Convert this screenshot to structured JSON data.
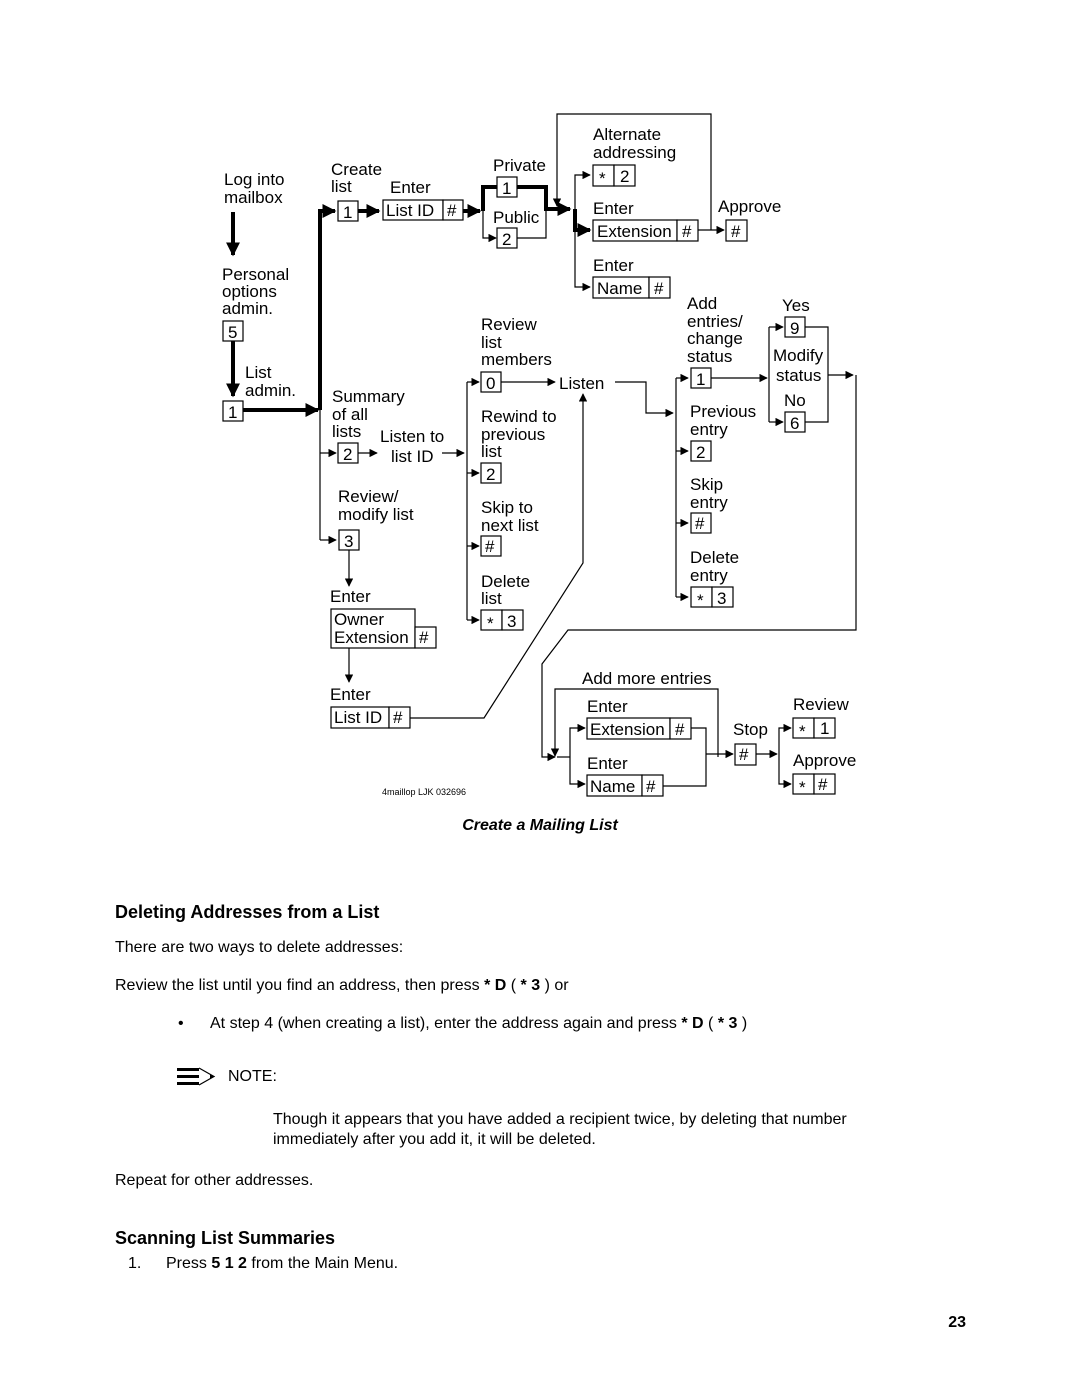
{
  "diagram": {
    "title": "Create a Mailing List",
    "credit": "4maillop LJK 032696",
    "labels": {
      "log_into": "Log into",
      "mailbox": "mailbox",
      "personal": "Personal",
      "options": "options",
      "admin": "admin.",
      "key_5": "5",
      "list": "List",
      "list_admin": "admin.",
      "key_1_admin": "1",
      "create": "Create",
      "create_list": "list",
      "key_1_create": "1",
      "enter_listid": "Enter",
      "listid": "List ID",
      "hash": "#",
      "private": "Private",
      "key_private": "1",
      "public": "Public",
      "key_public": "2",
      "alternate": "Alternate",
      "addressing": "addressing",
      "star": "*",
      "key_alt": "2",
      "enter_ext": "Enter",
      "extension": "Extension",
      "approve": "Approve",
      "enter_name": "Enter",
      "name": "Name",
      "summary": "Summary",
      "of_all": "of all",
      "lists": "lists",
      "key_summary": "2",
      "listen_to": "Listen to",
      "list_id": "list ID",
      "review_modify": "Review/",
      "modify_list": "modify list",
      "key_review": "3",
      "enter_owner": "Enter",
      "owner": "Owner",
      "owner_ext": "Extension",
      "enter_listid2": "Enter",
      "listid2": "List ID",
      "review": "Review",
      "review_list": "list",
      "members": "members",
      "key_0": "0",
      "listen": "Listen",
      "rewind_to": "Rewind to",
      "previous": "previous",
      "rewind_list": "list",
      "key_rewind": "2",
      "skip_to": "Skip to",
      "next_list": "next list",
      "delete": "Delete",
      "delete_list": "list",
      "key_delete": "3",
      "add": "Add",
      "entries": "entries/",
      "change": "change",
      "status": "status",
      "key_add": "1",
      "prev_entry": "Previous",
      "entry": "entry",
      "key_prev": "2",
      "skip": "Skip",
      "skip_entry": "entry",
      "delete2": "Delete",
      "delete_entry": "entry",
      "key_del_entry": "3",
      "yes": "Yes",
      "key_yes": "9",
      "modify": "Modify",
      "modify_status": "status",
      "no": "No",
      "key_no": "6",
      "add_more": "Add more entries",
      "enter_ext2": "Enter",
      "extension2": "Extension",
      "enter_name2": "Enter",
      "name2": "Name",
      "stop": "Stop",
      "review2": "Review",
      "key_review2": "1",
      "approve2": "Approve"
    }
  },
  "section1": {
    "heading": "Deleting Addresses from a List",
    "intro": "There are two ways to delete addresses:",
    "way1_prefix": "Review the list until you find an address, then press ",
    "way1_bold1": "* D",
    "way1_mid": " ( ",
    "way1_bold2": "* 3",
    "way1_suffix": " ) or",
    "bullet_char": "•",
    "bullet_prefix": "At step 4 (when creating a list), enter the address again and press ",
    "bullet_bold1": "* D",
    "bullet_mid": " ( ",
    "bullet_bold2": "* 3",
    "bullet_suffix": " )",
    "note_label": "NOTE:",
    "note_text": "Though it appears that you have added a recipient twice, by deleting that number immediately after you add it, it will be deleted.",
    "repeat": "Repeat for other addresses."
  },
  "section2": {
    "heading": "Scanning List Summaries",
    "step_num": "1.",
    "step_prefix": "Press ",
    "step_bold": "5 1 2",
    "step_suffix": " from the Main Menu."
  },
  "page_number": "23"
}
